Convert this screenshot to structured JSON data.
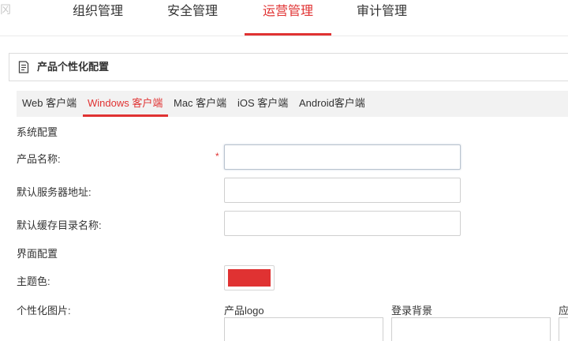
{
  "top_nav": {
    "items": [
      {
        "label": "组织管理"
      },
      {
        "label": "安全管理"
      },
      {
        "label": "运营管理",
        "active": true
      },
      {
        "label": "审计管理"
      }
    ],
    "edge_glyph": "冈"
  },
  "section": {
    "title": "产品个性化配置",
    "icon": "document-list-icon"
  },
  "tabs": [
    {
      "label": "Web 客户端"
    },
    {
      "label": "Windows 客户端",
      "active": true
    },
    {
      "label": "Mac 客户端"
    },
    {
      "label": "iOS 客户端"
    },
    {
      "label": "Android客户端"
    }
  ],
  "system_config": {
    "title": "系统配置",
    "product_name": {
      "label": "产品名称:",
      "required_mark": "*",
      "value": ""
    },
    "default_server": {
      "label": "默认服务器地址:",
      "value": ""
    },
    "default_cache_dir": {
      "label": "默认缓存目录名称:",
      "value": ""
    }
  },
  "ui_config": {
    "title": "界面配置",
    "theme_color": {
      "label": "主题色:",
      "color": "#e03232"
    },
    "custom_images": {
      "label": "个性化图片:",
      "items": [
        {
          "label": "产品logo"
        },
        {
          "label": "登录背景"
        },
        {
          "label": "应"
        }
      ]
    }
  },
  "colors": {
    "accent": "#e03232",
    "tab_bar_bg": "#f2f2f2"
  }
}
